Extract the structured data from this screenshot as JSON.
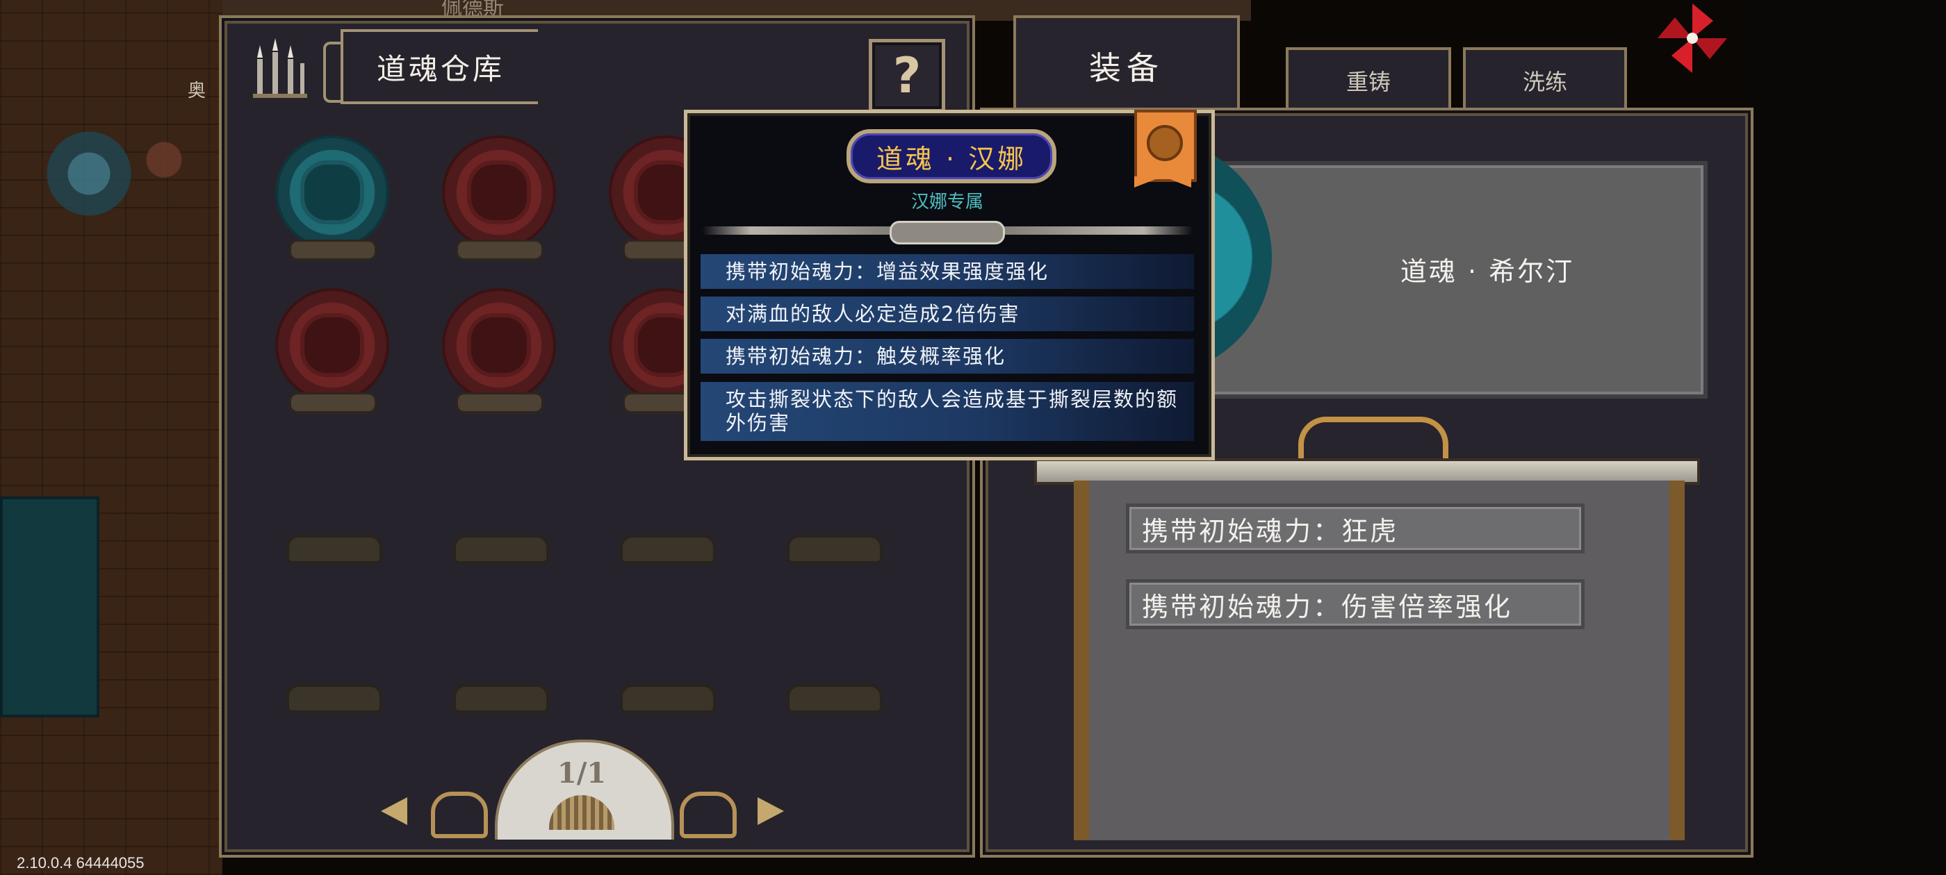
{
  "background": {
    "npc_left_label": "奥",
    "npc_top_label": "佩德斯"
  },
  "storage": {
    "title": "道魂仓库",
    "help_label": "?",
    "page_indicator": "1/1",
    "souls": [
      {
        "color": "teal"
      },
      {
        "color": "red"
      },
      {
        "color": "red"
      },
      {
        "color": "red"
      },
      {
        "color": "red"
      },
      {
        "color": "red"
      }
    ],
    "empty_slots": 8
  },
  "tabs": {
    "equip": "装备",
    "recast": "重铸",
    "refine": "洗练"
  },
  "equipped": {
    "name": "道魂 · 希尔汀",
    "stats": [
      "携带初始魂力：狂虎",
      "携带初始魂力：伤害倍率强化"
    ]
  },
  "tooltip": {
    "title": "道魂 · 汉娜",
    "subtitle": "汉娜专属",
    "effects": [
      "携带初始魂力：增益效果强度强化",
      "对满血的敌人必定造成2倍伤害",
      "携带初始魂力：触发概率强化",
      "攻击撕裂状态下的敌人会造成基于撕裂层数的额外伤害"
    ]
  },
  "version": "2.10.0.4 64444055",
  "colors": {
    "accent_gold": "#f5c64a",
    "teal_text": "#4dbfc2",
    "panel_bg": "#26232c",
    "frame": "#8b7a5a"
  }
}
